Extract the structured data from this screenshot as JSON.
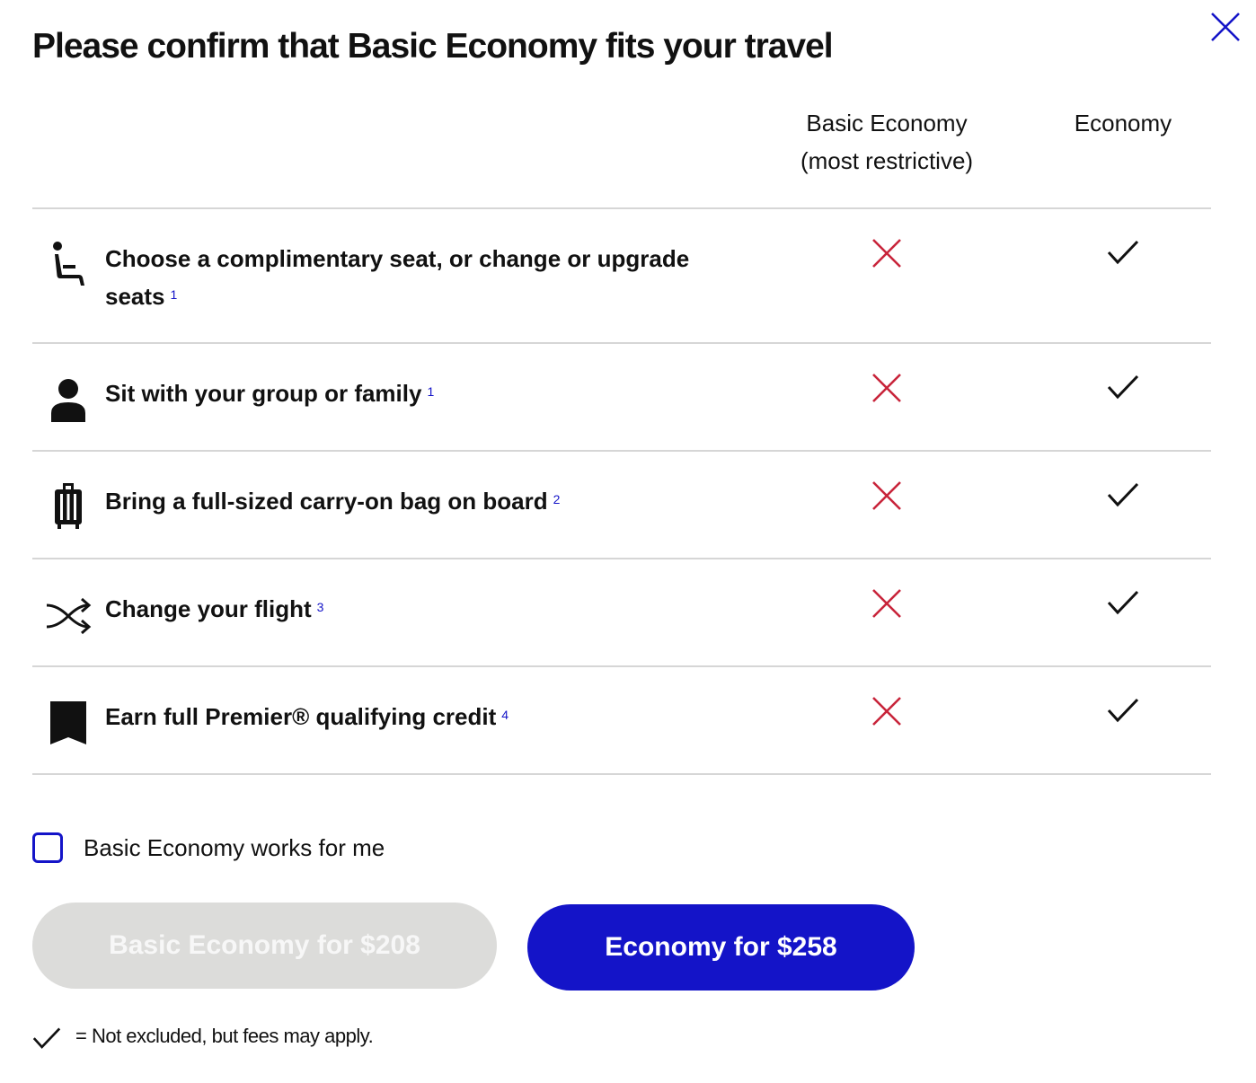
{
  "dialog": {
    "title": "Please confirm that Basic Economy fits your travel",
    "close_icon": "close-x-icon",
    "accent_color": "#1414c8",
    "not_included_color": "#c8243a"
  },
  "columns": {
    "basic_title": "Basic Economy",
    "basic_subtitle": "(most restrictive)",
    "economy_title": "Economy"
  },
  "rows": [
    {
      "icon": "seat-icon",
      "label": "Choose a complimentary seat, or change or upgrade seats",
      "footnote": "1",
      "basic": "cross-icon",
      "economy": "check-icon"
    },
    {
      "icon": "person-icon",
      "label": "Sit with your group or family",
      "footnote": "1",
      "basic": "cross-icon",
      "economy": "check-icon"
    },
    {
      "icon": "luggage-icon",
      "label": "Bring a full-sized carry-on bag on board",
      "footnote": "2",
      "basic": "cross-icon",
      "economy": "check-icon"
    },
    {
      "icon": "shuffle-icon",
      "label": "Change your flight",
      "footnote": "3",
      "basic": "cross-icon",
      "economy": "check-icon"
    },
    {
      "icon": "bookmark-icon",
      "label": "Earn full Premier® qualifying credit",
      "footnote": "4",
      "basic": "cross-icon",
      "economy": "check-icon"
    }
  ],
  "confirm": {
    "checkbox_label": "Basic Economy works for me",
    "checked": false
  },
  "buttons": {
    "basic_label": "Basic Economy for $208",
    "economy_label": "Economy for $258"
  },
  "legend": {
    "icon": "check-icon",
    "text": "= Not excluded, but fees may apply."
  }
}
